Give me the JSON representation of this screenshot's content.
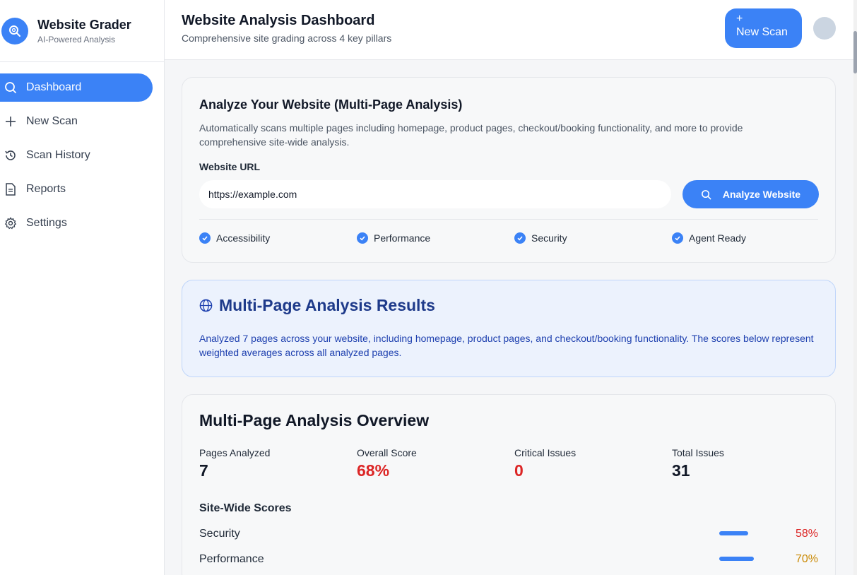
{
  "brand": {
    "title": "Website Grader",
    "subtitle": "AI-Powered Analysis"
  },
  "sidebar": {
    "items": [
      {
        "label": "Dashboard",
        "icon": "search-icon",
        "active": true
      },
      {
        "label": "New Scan",
        "icon": "plus-icon",
        "active": false
      },
      {
        "label": "Scan History",
        "icon": "history-icon",
        "active": false
      },
      {
        "label": "Reports",
        "icon": "document-icon",
        "active": false
      },
      {
        "label": "Settings",
        "icon": "gear-icon",
        "active": false
      }
    ]
  },
  "header": {
    "title": "Website Analysis Dashboard",
    "subtitle": "Comprehensive site grading across 4 key pillars",
    "new_scan_plus": "+",
    "new_scan_label": "New Scan"
  },
  "analyze": {
    "title": "Analyze Your Website (Multi-Page Analysis)",
    "description": "Automatically scans multiple pages including homepage, product pages, checkout/booking functionality, and more to provide comprehensive site-wide analysis.",
    "url_label": "Website URL",
    "url_value": "https://example.com",
    "button_label": "Analyze Website",
    "pillars": [
      "Accessibility",
      "Performance",
      "Security",
      "Agent Ready"
    ]
  },
  "results": {
    "title": "Multi-Page Analysis Results",
    "description": "Analyzed 7 pages across your website, including homepage, product pages, and checkout/booking functionality. The scores below represent weighted averages across all analyzed pages."
  },
  "overview": {
    "title": "Multi-Page Analysis Overview",
    "stats": [
      {
        "label": "Pages Analyzed",
        "value": "7",
        "color": "#111827"
      },
      {
        "label": "Overall Score",
        "value": "68%",
        "color": "#dc2626"
      },
      {
        "label": "Critical Issues",
        "value": "0",
        "color": "#dc2626"
      },
      {
        "label": "Total Issues",
        "value": "31",
        "color": "#111827"
      }
    ],
    "scores_title": "Site-Wide Scores",
    "scores": [
      {
        "name": "Security",
        "value": "58%",
        "level": 0.58,
        "color": "#dc2626"
      },
      {
        "name": "Performance",
        "value": "70%",
        "level": 0.7,
        "color": "#ca8a04"
      }
    ]
  },
  "colors": {
    "accent": "#3b82f6",
    "danger": "#dc2626",
    "warning": "#ca8a04"
  }
}
